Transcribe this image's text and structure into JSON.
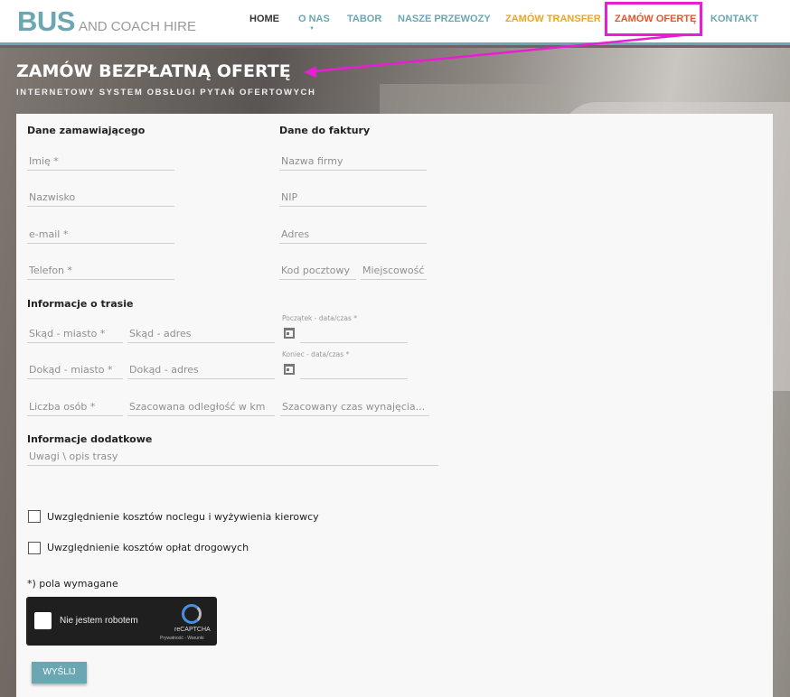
{
  "logo": {
    "main": "BUS",
    "sub": "AND COACH HIRE"
  },
  "nav": {
    "items": [
      {
        "label": "HOME"
      },
      {
        "label": "O NAS"
      },
      {
        "label": "TABOR"
      },
      {
        "label": "NASZE PRZEWOZY"
      },
      {
        "label": "ZAMÓW TRANSFER"
      },
      {
        "label": "ZAMÓW OFERTĘ"
      },
      {
        "label": "KONTAKT"
      }
    ]
  },
  "hero": {
    "title": "ZAMÓW BEZPŁATNĄ OFERTĘ",
    "subtitle": "INTERNETOWY SYSTEM OBSŁUGI PYTAŃ OFERTOWYCH"
  },
  "form": {
    "sections": {
      "customer": "Dane zamawiającego",
      "invoice": "Dane do faktury",
      "route": "Informacje o trasie",
      "extra": "Informacje dodatkowe"
    },
    "fields": {
      "first_name": "Imię",
      "last_name": "Nazwisko",
      "email": "e-mail",
      "phone": "Telefon",
      "company": "Nazwa firmy",
      "nip": "NIP",
      "address": "Adres",
      "postal_code": "Kod pocztowy",
      "city": "Miejscowość",
      "from_city": "Skąd - miasto",
      "from_address": "Skąd - adres",
      "to_city": "Dokąd - miasto",
      "to_address": "Dokąd - adres",
      "people": "Liczba osób",
      "distance": "Szacowana odległość w km",
      "rental_time": "Szacowany czas wynajęcia...",
      "start_label": "Początek - data/czas",
      "end_label": "Koniec - data/czas",
      "notes": "Uwagi \\ opis trasy"
    },
    "required_mark": "*",
    "checkboxes": [
      "Uwzględnienie kosztów noclegu i wyżywienia kierowcy",
      "Uwzględnienie kosztów opłat drogowych"
    ],
    "required_note": "*) pola wymagane",
    "recaptcha": {
      "label": "Nie jestem robotem",
      "brand": "reCAPTCHA",
      "terms": "Prywatność - Warunki"
    },
    "submit": "WYŚLIJ"
  },
  "colors": {
    "accent": "#6aa7b3",
    "orange": "#f2a51a",
    "red": "#e4572e",
    "highlight": "#e91ed2"
  }
}
